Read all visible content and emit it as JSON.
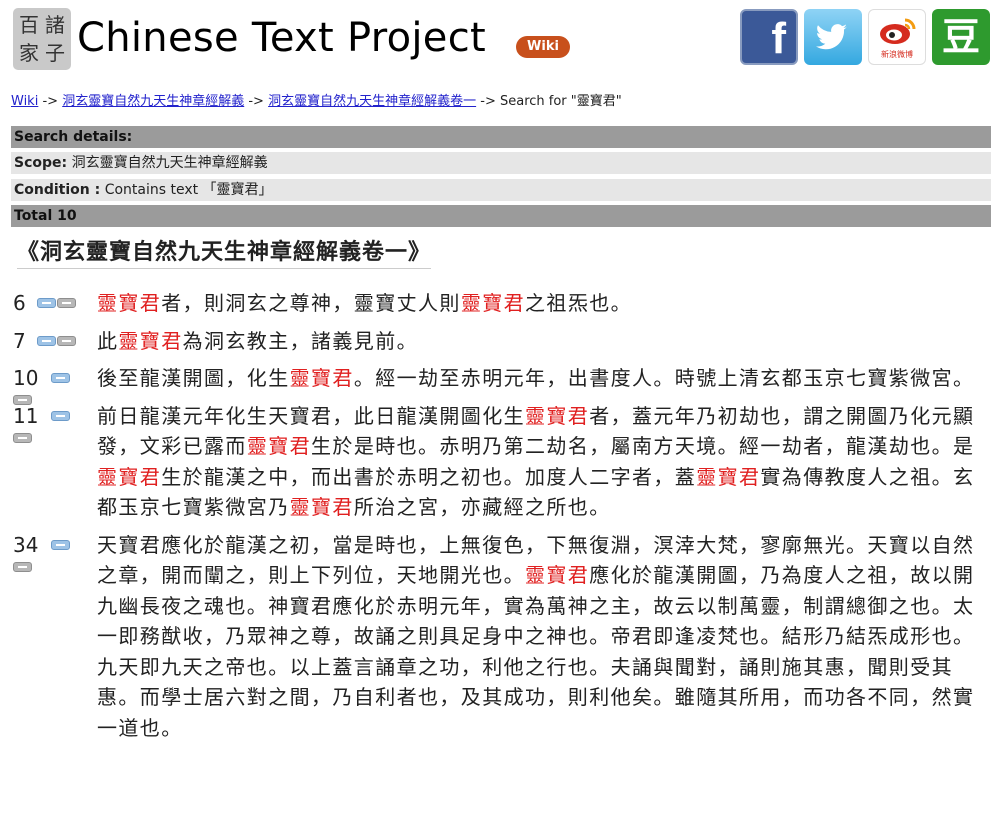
{
  "header": {
    "logo_chars": [
      "百",
      "諸",
      "家",
      "子"
    ],
    "title": "Chinese Text Project",
    "badge": "Wiki",
    "social": {
      "facebook": "f",
      "weibo_caption": "新浪微博",
      "douban": "豆"
    }
  },
  "breadcrumb": {
    "items": [
      "Wiki",
      "洞玄靈寶自然九天生神章經解義",
      "洞玄靈寶自然九天生神章經解義卷一"
    ],
    "separator": "->",
    "current": "Search for \"靈寶君\""
  },
  "search_details": {
    "heading": "Search details:",
    "scope_label": "Scope:",
    "scope_value": "洞玄靈寶自然九天生神章經解義",
    "condition_label": "Condition :",
    "condition_value": "Contains text 「靈寶君」",
    "total": "Total 10"
  },
  "chapter_title": "《洞玄靈寶自然九天生神章經解義卷一》",
  "highlight_term": "靈寶君",
  "colors": {
    "highlight": "#e02020",
    "dark_row": "#9b9b9b",
    "light_row": "#e6e6e6",
    "link": "#2222cc"
  },
  "results": [
    {
      "number": "6",
      "text": "靈寶君者，則洞玄之尊神，靈寶丈人則靈寶君之祖炁也。"
    },
    {
      "number": "7",
      "text": "此靈寶君為洞玄教主，諸義見前。"
    },
    {
      "number": "10",
      "text": "後至龍漢開圖，化生靈寶君。經一劫至赤明元年，出書度人。時號上清玄都玉京七寶紫微宮。"
    },
    {
      "number": "11",
      "text": "前日龍漢元年化生天寶君，此日龍漢開圖化生靈寶君者，蓋元年乃初劫也，謂之開圖乃化元顯發，文彩已露而靈寶君生於是時也。赤明乃第二劫名，屬南方天境。經一劫者，龍漢劫也。是靈寶君生於龍漢之中，而出書於赤明之初也。加度人二字者，蓋靈寶君實為傳教度人之祖。玄都玉京七寶紫微宮乃靈寶君所治之宮，亦藏經之所也。"
    },
    {
      "number": "34",
      "text": "天寶君應化於龍漢之初，當是時也，上無復色，下無復淵，溟涬大梵，寥廓無光。天寶以自然之章，開而闡之，則上下列位，天地開光也。靈寶君應化於龍漢開圖，乃為度人之祖，故以開九幽長夜之魂也。神寶君應化於赤明元年，實為萬神之主，故云以制萬靈，制謂總御之也。太一即務猷收，乃眾神之尊，故誦之則具足身中之神也。帝君即逢凌梵也。結形乃結炁成形也。九天即九天之帝也。以上蓋言誦章之功，利他之行也。夫誦與聞對，誦則施其惠，聞則受其惠。而學士居六對之間，乃自利者也，及其成功，則利他矣。雖隨其所用，而功各不同，然實一道也。"
    }
  ]
}
